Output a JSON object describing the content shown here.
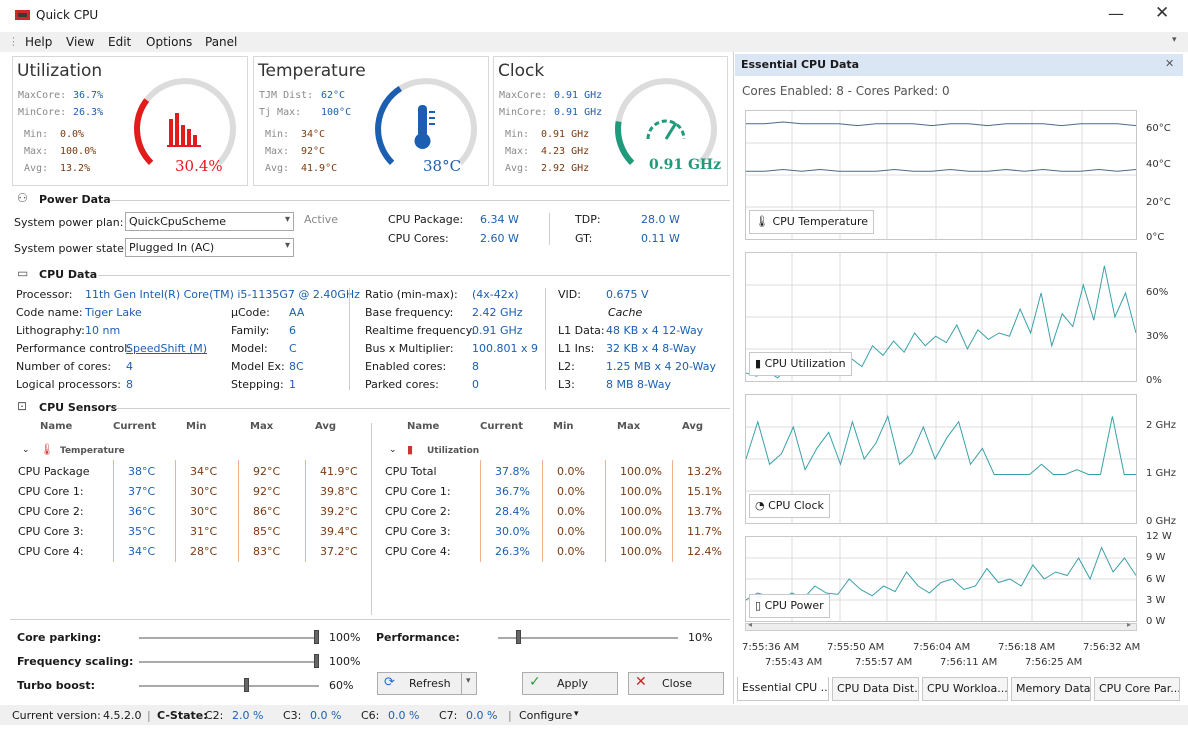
{
  "window": {
    "title": "Quick CPU"
  },
  "menu": [
    "Help",
    "View",
    "Edit",
    "Options",
    "Panel"
  ],
  "utilization": {
    "title": "Utilization",
    "maxcore_label": "MaxCore:",
    "maxcore": "36.7%",
    "mincore_label": "MinCore:",
    "mincore": "26.3%",
    "min_label": "Min:",
    "min": "0.0%",
    "max_label": "Max:",
    "max": "100.0%",
    "avg_label": "Avg:",
    "avg": "13.2%",
    "gauge_value": "30.4%",
    "gauge_fraction": 0.304,
    "color": "#e21b1b"
  },
  "temperature": {
    "title": "Temperature",
    "tjm_label": "TJM Dist:",
    "tjm": "62°C",
    "tjmax_label": "Tj Max:",
    "tjmax": "100°C",
    "min_label": "Min:",
    "min": "34°C",
    "max_label": "Max:",
    "max": "92°C",
    "avg_label": "Avg:",
    "avg": "41.9°C",
    "gauge_value": "38°C",
    "gauge_fraction": 0.38,
    "color": "#1c5fb0"
  },
  "clock": {
    "title": "Clock",
    "maxcore_label": "MaxCore:",
    "maxcore": "0.91 GHz",
    "mincore_label": "MinCore:",
    "mincore": "0.91 GHz",
    "min_label": "Min:",
    "min": "0.91 GHz",
    "max_label": "Max:",
    "max": "4.23 GHz",
    "avg_label": "Avg:",
    "avg": "2.92 GHz",
    "gauge_value": "0.91 GHz",
    "gauge_fraction": 0.2,
    "color": "#1f9a7a"
  },
  "power": {
    "section": "Power Data",
    "plan_label": "System power plan:",
    "plan": "QuickCpuScheme",
    "active": "Active",
    "state_label": "System power state:",
    "state": "Plugged In (AC)",
    "pkg_label": "CPU Package:",
    "pkg": "6.34 W",
    "cores_label": "CPU Cores:",
    "cores": "2.60 W",
    "tdp_label": "TDP:",
    "tdp": "28.0 W",
    "gt_label": "GT:",
    "gt": "0.11 W"
  },
  "cpudata": {
    "section": "CPU Data",
    "processor_label": "Processor:",
    "processor": "11th Gen Intel(R) Core(TM) i5-1135G7 @ 2.40GHz",
    "code_label": "Code name:",
    "code": "Tiger Lake",
    "litho_label": "Lithography:",
    "litho": "10 nm",
    "perf_label": "Performance control:",
    "perf": "SpeedShift (M)",
    "cores_label": "Number of cores:",
    "cores": "4",
    "logical_label": "Logical processors:",
    "logical": "8",
    "ucode_label": "µCode:",
    "ucode": "AA",
    "family_label": "Family:",
    "family": "6",
    "model_label": "Model:",
    "model": "C",
    "modelex_label": "Model Ex:",
    "modelex": "8C",
    "stepping_label": "Stepping:",
    "stepping": "1",
    "ratio_label": "Ratio (min-max):",
    "ratio": "(4x-42x)",
    "base_label": "Base frequency:",
    "base": "2.42 GHz",
    "rt_label": "Realtime frequency:",
    "rt": "0.91 GHz",
    "bus_label": "Bus x Multiplier:",
    "bus": "100.801 x 9",
    "enabled_label": "Enabled cores:",
    "enabled": "8",
    "parked_label": "Parked cores:",
    "parked": "0",
    "vid_label": "VID:",
    "vid": "0.675 V",
    "cache": "Cache",
    "l1d_label": "L1 Data:",
    "l1d": "48 KB x 4  12-Way",
    "l1i_label": "L1 Ins:",
    "l1i": "32 KB x 4  8-Way",
    "l2_label": "L2:",
    "l2": "1.25 MB x 4  20-Way",
    "l3_label": "L3:",
    "l3": "8 MB  8-Way"
  },
  "sensors": {
    "section": "CPU Sensors",
    "headers": [
      "Name",
      "Current",
      "Min",
      "Max",
      "Avg"
    ],
    "temp_group": "Temperature",
    "temp_rows": [
      [
        "CPU Package",
        "38°C",
        "34°C",
        "92°C",
        "41.9°C"
      ],
      [
        "CPU Core 1:",
        "37°C",
        "30°C",
        "92°C",
        "39.8°C"
      ],
      [
        "CPU Core 2:",
        "36°C",
        "30°C",
        "86°C",
        "39.2°C"
      ],
      [
        "CPU Core 3:",
        "35°C",
        "31°C",
        "85°C",
        "39.4°C"
      ],
      [
        "CPU Core 4:",
        "34°C",
        "28°C",
        "83°C",
        "37.2°C"
      ]
    ],
    "util_group": "Utilization",
    "util_rows": [
      [
        "CPU Total",
        "37.8%",
        "0.0%",
        "100.0%",
        "13.2%"
      ],
      [
        "CPU Core 1:",
        "36.7%",
        "0.0%",
        "100.0%",
        "15.1%"
      ],
      [
        "CPU Core 2:",
        "28.4%",
        "0.0%",
        "100.0%",
        "13.7%"
      ],
      [
        "CPU Core 3:",
        "30.0%",
        "0.0%",
        "100.0%",
        "11.7%"
      ],
      [
        "CPU Core 4:",
        "26.3%",
        "0.0%",
        "100.0%",
        "12.4%"
      ]
    ]
  },
  "controls": {
    "parking_label": "Core parking:",
    "parking": "100%",
    "parking_value": 1.0,
    "freq_label": "Frequency scaling:",
    "freq": "100%",
    "freq_value": 1.0,
    "turbo_label": "Turbo boost:",
    "turbo": "60%",
    "turbo_value": 0.6,
    "perf_label": "Performance:",
    "perf": "10%",
    "perf_value": 0.1,
    "refresh": "Refresh",
    "apply": "Apply",
    "close": "Close"
  },
  "status": {
    "version_label": "Current version:",
    "version": "4.5.2.0",
    "cstate_label": "C-State:",
    "c2_label": "C2:",
    "c2": "2.0 %",
    "c3_label": "C3:",
    "c3": "0.0 %",
    "c6_label": "C6:",
    "c6": "0.0 %",
    "c7_label": "C7:",
    "c7": "0.0 %",
    "configure": "Configure"
  },
  "panel": {
    "title": "Essential CPU Data",
    "cores_text": "Cores Enabled: 8 - Cores Parked: 0",
    "graphs": [
      {
        "label": "CPU Temperature",
        "axis": [
          "60°C",
          "40°C",
          "20°C",
          "0°C"
        ]
      },
      {
        "label": "CPU Utilization",
        "axis": [
          "60%",
          "30%",
          "0%"
        ]
      },
      {
        "label": "CPU Clock",
        "axis": [
          "2 GHz",
          "1 GHz",
          "0 GHz"
        ]
      },
      {
        "label": "CPU Power",
        "axis": [
          "12 W",
          "9 W",
          "6 W",
          "3 W",
          "0 W"
        ]
      }
    ],
    "times_top": [
      "7:55:36 AM",
      "7:55:50 AM",
      "7:56:04 AM",
      "7:56:18 AM",
      "7:56:32 AM"
    ],
    "times_bottom": [
      "7:55:43 AM",
      "7:55:57 AM",
      "7:56:11 AM",
      "7:56:25 AM"
    ],
    "tabs": [
      "Essential CPU ...",
      "CPU Data Dist...",
      "CPU Workloa...",
      "Memory Data",
      "CPU Core Par..."
    ]
  },
  "chart_data": [
    {
      "type": "line",
      "series": [
        {
          "name": "CPU Temperature",
          "values": [
            63,
            63,
            64,
            63,
            63,
            63,
            62,
            63,
            63,
            63,
            62,
            63,
            63,
            62,
            63,
            63,
            63,
            62,
            63,
            63,
            63,
            62
          ]
        },
        {
          "name": "CPU Temperature",
          "values": [
            37,
            37,
            38,
            37,
            38,
            37,
            37,
            37,
            38,
            37,
            37,
            38,
            37,
            37,
            38,
            37,
            38,
            37,
            37,
            38,
            37,
            38
          ]
        }
      ],
      "ylim": [
        0,
        70
      ]
    },
    {
      "type": "line",
      "series": [
        {
          "name": "CPU Utilization",
          "values": [
            5,
            3,
            6,
            2,
            8,
            4,
            12,
            5,
            18,
            10,
            14,
            9,
            22,
            16,
            25,
            18,
            30,
            22,
            28,
            24,
            35,
            20,
            32,
            26,
            30,
            28,
            45,
            30,
            55,
            22,
            42,
            34,
            60,
            38,
            72,
            40,
            55,
            30
          ]
        }
      ],
      "ylim": [
        0,
        80
      ]
    },
    {
      "type": "line",
      "series": [
        {
          "name": "CPU Clock",
          "values": [
            1.2,
            1.9,
            1.1,
            1.3,
            1.8,
            1.0,
            1.4,
            1.7,
            1.1,
            1.9,
            1.2,
            1.5,
            2.0,
            1.1,
            1.3,
            1.8,
            1.2,
            1.6,
            1.9,
            1.1,
            1.4,
            0.91,
            0.91,
            0.91,
            0.91,
            1.1,
            0.91,
            0.91,
            1.0,
            0.91,
            0.91,
            2.0,
            0.91,
            0.91
          ]
        }
      ],
      "ylim": [
        0,
        2.4
      ]
    },
    {
      "type": "line",
      "series": [
        {
          "name": "CPU Power",
          "values": [
            3,
            4,
            3.5,
            3,
            4,
            3.2,
            5,
            4,
            3.8,
            6,
            4.5,
            3.6,
            5,
            4.2,
            7,
            5,
            4,
            5.5,
            6,
            4.5,
            5,
            7.5,
            5.5,
            6,
            5,
            8,
            6,
            7,
            6.5,
            9,
            6,
            10.5,
            7,
            9,
            6.5
          ]
        }
      ],
      "ylim": [
        0,
        12
      ]
    }
  ]
}
